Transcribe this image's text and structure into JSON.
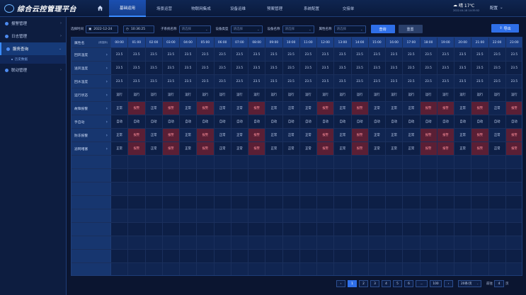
{
  "app": {
    "title": "综合云控管理平台"
  },
  "nav": {
    "items": [
      "基础运用",
      "场景运营",
      "物联网集成",
      "设备运维",
      "预案管理",
      "系统配置",
      "交接单"
    ],
    "active_index": 0
  },
  "weather": {
    "temp": "晴 17℃",
    "date": "2022-04-18 14:35:52"
  },
  "user": {
    "name": "配置"
  },
  "sidebar": {
    "items": [
      {
        "label": "报警管理"
      },
      {
        "label": "日志管理"
      },
      {
        "label": "服务查询"
      },
      {
        "label": "联动管理"
      }
    ],
    "sub_item": "历史数据"
  },
  "filters": {
    "time_label": "选择时间",
    "date": "2022-12-24",
    "time": "10:36:25",
    "subsystem_label": "子系统名称",
    "subsystem_placeholder": "请选择",
    "device_type_label": "设备类型",
    "device_type_placeholder": "请选择",
    "device_name_label": "设备名称",
    "device_name_placeholder": "请选择",
    "attr_label": "属性名称",
    "attr_placeholder": "请选择",
    "query": "查询",
    "reset": "重置",
    "export": "导出"
  },
  "table": {
    "head_label": "属性名",
    "head_sub": "(请选择)",
    "times": [
      "00:00",
      "01:00",
      "02:00",
      "03:00",
      "04:00",
      "05:00",
      "06:00",
      "07:00",
      "08:00",
      "09:00",
      "10:00",
      "11:00",
      "12:00",
      "13:00",
      "14:00",
      "15:00",
      "16:00",
      "17:00",
      "18:00",
      "19:00",
      "20:00",
      "21:00",
      "22:00",
      "23:00"
    ],
    "rows": [
      {
        "label": "回风温度",
        "values": [
          "23.5",
          "23.5",
          "23.5",
          "23.5",
          "23.5",
          "23.5",
          "23.5",
          "23.5",
          "23.5",
          "23.5",
          "23.5",
          "23.5",
          "23.5",
          "23.5",
          "23.5",
          "23.5",
          "23.5",
          "23.5",
          "23.5",
          "23.5",
          "23.5",
          "23.5",
          "23.5",
          "23.5"
        ]
      },
      {
        "label": "送风温度",
        "values": [
          "23.5",
          "23.5",
          "23.5",
          "23.5",
          "23.5",
          "23.5",
          "23.5",
          "23.5",
          "23.5",
          "23.5",
          "23.5",
          "23.5",
          "23.5",
          "23.5",
          "23.5",
          "23.5",
          "23.5",
          "23.5",
          "23.5",
          "23.5",
          "23.5",
          "23.5",
          "23.5",
          "23.5"
        ]
      },
      {
        "label": "回水温度",
        "values": [
          "23.5",
          "23.5",
          "23.5",
          "23.5",
          "23.5",
          "23.5",
          "23.5",
          "23.5",
          "23.5",
          "23.5",
          "23.5",
          "23.5",
          "23.5",
          "23.5",
          "23.5",
          "23.5",
          "23.5",
          "23.5",
          "23.5",
          "23.5",
          "23.5",
          "23.5",
          "23.5",
          "23.5"
        ]
      },
      {
        "label": "运行状态",
        "values": [
          "运行",
          "运行",
          "运行",
          "运行",
          "运行",
          "运行",
          "运行",
          "运行",
          "运行",
          "运行",
          "运行",
          "运行",
          "运行",
          "运行",
          "运行",
          "运行",
          "运行",
          "运行",
          "运行",
          "运行",
          "运行",
          "运行",
          "运行",
          "运行"
        ]
      },
      {
        "label": "故障报警",
        "values": [
          "正常",
          "报警",
          "正常",
          "报警",
          "正常",
          "报警",
          "正常",
          "正常",
          "报警",
          "正常",
          "正常",
          "正常",
          "报警",
          "正常",
          "报警",
          "正常",
          "正常",
          "正常",
          "报警",
          "报警",
          "正常",
          "报警",
          "正常",
          "报警"
        ]
      },
      {
        "label": "手自动",
        "values": [
          "自动",
          "自动",
          "自动",
          "自动",
          "自动",
          "自动",
          "自动",
          "自动",
          "自动",
          "自动",
          "自动",
          "自动",
          "自动",
          "自动",
          "自动",
          "自动",
          "自动",
          "自动",
          "自动",
          "自动",
          "自动",
          "自动",
          "自动",
          "自动"
        ]
      },
      {
        "label": "防冻报警",
        "values": [
          "正常",
          "报警",
          "正常",
          "报警",
          "正常",
          "报警",
          "正常",
          "正常",
          "报警",
          "正常",
          "正常",
          "正常",
          "报警",
          "正常",
          "报警",
          "正常",
          "正常",
          "正常",
          "报警",
          "报警",
          "正常",
          "报警",
          "正常",
          "报警"
        ]
      },
      {
        "label": "滤网堵塞",
        "values": [
          "正常",
          "报警",
          "正常",
          "报警",
          "正常",
          "报警",
          "正常",
          "正常",
          "报警",
          "正常",
          "正常",
          "正常",
          "报警",
          "正常",
          "报警",
          "正常",
          "正常",
          "正常",
          "报警",
          "报警",
          "正常",
          "报警",
          "正常",
          "报警"
        ]
      }
    ],
    "alarm_value": "报警",
    "empty_rows": 9
  },
  "pager": {
    "pages": [
      "1",
      "2",
      "3",
      "4",
      "5",
      "6",
      "...",
      "100"
    ],
    "active": "1",
    "prev": "‹",
    "next": "›",
    "page_size": "20条/页",
    "jump_label": "前往",
    "jump_value": "4",
    "jump_suffix": "页"
  },
  "colors": {
    "accent": "#2f6fe8",
    "alarm": "#ff8f9c"
  }
}
